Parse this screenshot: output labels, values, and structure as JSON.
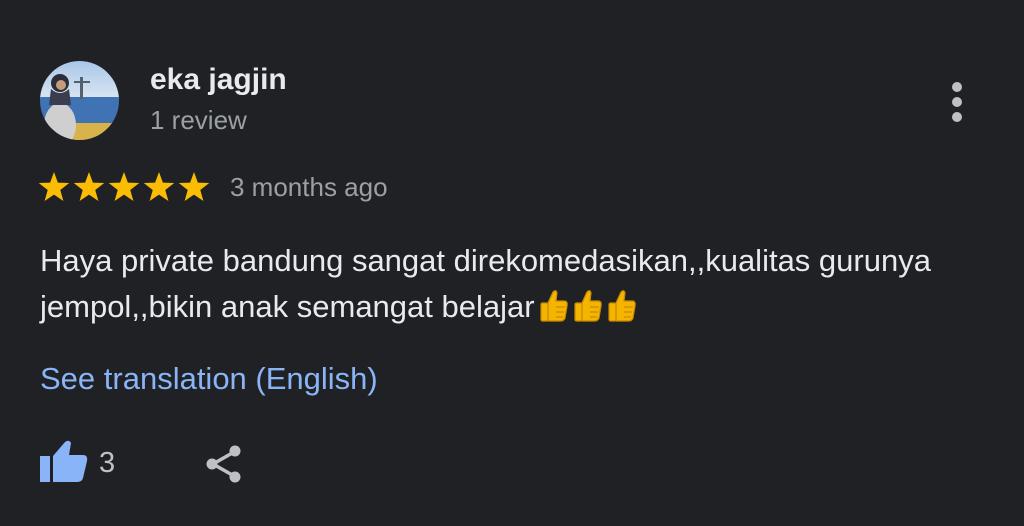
{
  "review": {
    "author": "eka jagjin",
    "author_review_count": "1 review",
    "rating": 5,
    "rating_max": 5,
    "time_ago": "3 months ago",
    "text": "Haya private bandung sangat direkomedasikan,,kualitas gurunya jempol,,bikin anak semangat belajar",
    "trailing_emoji": [
      "thumbs-up-icon",
      "thumbs-up-icon",
      "thumbs-up-icon"
    ],
    "translate_label": "See translation (English)",
    "like_count": "3"
  },
  "icons": {
    "more": "more-vert-icon",
    "like": "thumb-up-icon",
    "share": "share-icon",
    "star": "star-icon"
  },
  "colors": {
    "background": "#202124",
    "star": "#fbbc04",
    "link": "#8ab4f8",
    "like": "#8ab4f8",
    "primary_text": "#e8eaed",
    "secondary_text": "#9aa0a6"
  }
}
